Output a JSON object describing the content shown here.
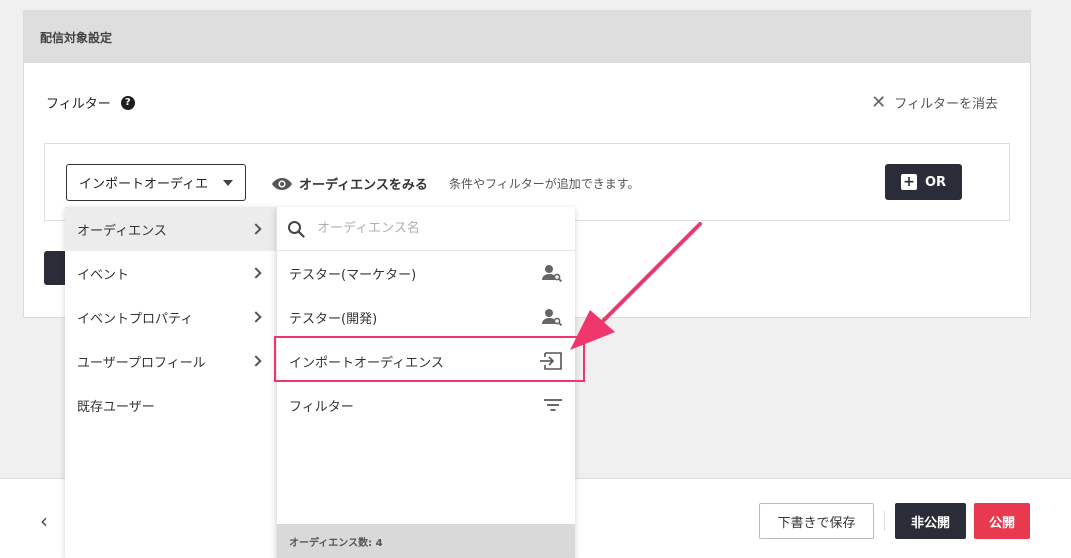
{
  "panel": {
    "title": "配信対象設定"
  },
  "filter": {
    "label": "フィルター",
    "help_glyph": "?",
    "clear_label": "フィルターを消去"
  },
  "condition": {
    "select_value": "インポートオーディエ",
    "view_audience_label": "オーディエンスをみる",
    "hint": "条件やフィルターが追加できます。",
    "or_label": "OR"
  },
  "menu_left": {
    "items": [
      {
        "label": "オーディエンス"
      },
      {
        "label": "イベント"
      },
      {
        "label": "イベントプロパティ"
      },
      {
        "label": "ユーザープロフィール"
      },
      {
        "label": "既存ユーザー"
      }
    ]
  },
  "menu_right": {
    "search_placeholder": "オーディエンス名",
    "items": [
      {
        "label": "テスター(マーケター)",
        "icon": "user-search-icon"
      },
      {
        "label": "テスター(開発)",
        "icon": "user-search-icon"
      },
      {
        "label": "インポートオーディエンス",
        "icon": "import-icon"
      },
      {
        "label": "フィルター",
        "icon": "filter-icon"
      }
    ],
    "count_label": "オーディエンス数: 4"
  },
  "footer": {
    "save_draft": "下書きで保存",
    "unpublish": "非公開",
    "publish": "公開"
  },
  "colors": {
    "accent": "#e8394f",
    "dark": "#2a2d38",
    "highlight": "#f0376d"
  }
}
